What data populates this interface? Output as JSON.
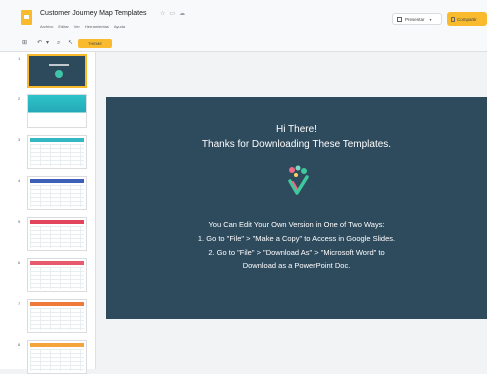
{
  "header": {
    "title": "Customer Journey Map Templates",
    "menu": [
      "Archivo",
      "Editar",
      "Ver",
      "Herramientas",
      "Ayuda"
    ],
    "present_label": "Presentar",
    "share_label": "Compartir"
  },
  "toolbar": {
    "theme_label": "THEME"
  },
  "filmstrip": {
    "slides": [
      {
        "number": "1"
      },
      {
        "number": "2"
      },
      {
        "number": "3"
      },
      {
        "number": "4"
      },
      {
        "number": "5"
      },
      {
        "number": "6"
      },
      {
        "number": "7"
      },
      {
        "number": "8"
      }
    ]
  },
  "slide": {
    "greeting": "Hi There!",
    "thanks": "Thanks for Downloading These Templates.",
    "intro": "You Can Edit Your Own Version in One of Two Ways:",
    "line1": "1.   Go to \"File\" > \"Make a Copy\" to Access in Google Slides.",
    "line2": "2.   Go to \"File\" > \"Download As\" > \"Microsoft Word\" to",
    "line3": "Download as a PowerPoint Doc."
  },
  "colors": {
    "accent": "#f9bb2d",
    "slide_bg": "#2e4a5d",
    "logo_green": "#3ec99c",
    "logo_pink": "#f06a84"
  }
}
